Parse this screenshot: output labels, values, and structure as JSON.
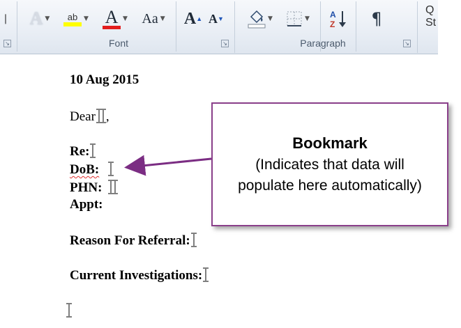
{
  "ribbon": {
    "font_group_label": "Font",
    "paragraph_group_label": "Paragraph",
    "styles_label_line1": "Q",
    "styles_label_line2": "St",
    "text_effects_glyph": "A",
    "highlight_glyph": "ab",
    "font_color_glyph": "A",
    "change_case_glyph": "Aa",
    "grow_font_glyph": "A",
    "shrink_font_glyph": "A",
    "sort_glyph": "A↓",
    "pilcrow_glyph": "¶",
    "highlight_color": "#ffff00",
    "font_color": "#e21d1d"
  },
  "document": {
    "date": "10 Aug 2015",
    "salutation": "Dear",
    "salutation_end": ",",
    "re_label": "Re:",
    "dob_label": "DoB:",
    "phn_label": "PHN:",
    "appt_label": "Appt:",
    "reason_label": "Reason For Referral:",
    "investigations_label": "Current Investigations:"
  },
  "callout": {
    "title": "Bookmark",
    "body": "(Indicates that data will populate here automatically)",
    "border_color": "#8a3f8a",
    "arrow_color": "#7b2d83"
  }
}
